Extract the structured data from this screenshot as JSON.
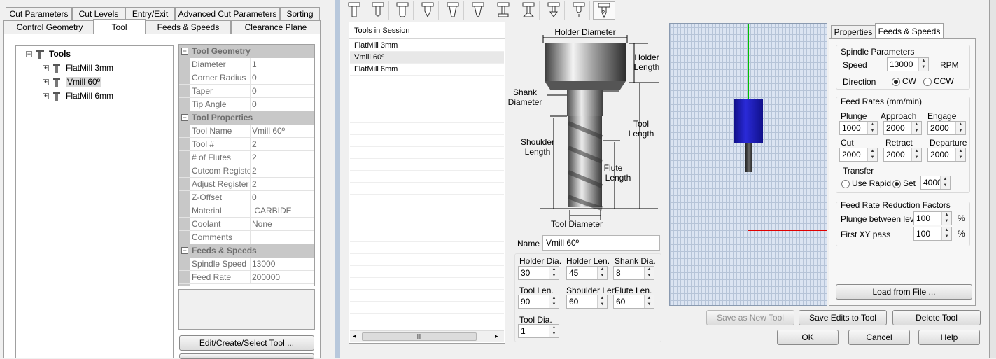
{
  "left_tabs_row1": [
    "Cut Parameters",
    "Cut Levels",
    "Entry/Exit",
    "Advanced Cut Parameters",
    "Sorting"
  ],
  "left_tabs_row2": [
    "Control Geometry",
    "Tool",
    "Feeds & Speeds",
    "Clearance Plane"
  ],
  "tree": {
    "root": "Tools",
    "items": [
      "FlatMill 3mm",
      "Vmill 60º",
      "FlatMill 6mm"
    ]
  },
  "property_grid": {
    "cat_geometry": "Tool Geometry",
    "geometry": [
      {
        "k": "Diameter",
        "v": "1"
      },
      {
        "k": "Corner Radius",
        "v": "0"
      },
      {
        "k": "Taper",
        "v": "0"
      },
      {
        "k": "Tip Angle",
        "v": "0"
      }
    ],
    "cat_properties": "Tool Properties",
    "properties": [
      {
        "k": "Tool Name",
        "v": "Vmill 60º"
      },
      {
        "k": "Tool #",
        "v": "2"
      },
      {
        "k": "# of Flutes",
        "v": "2"
      },
      {
        "k": "Cutcom Registe",
        "v": "2"
      },
      {
        "k": "Adjust Register",
        "v": "2"
      },
      {
        "k": "Z-Offset",
        "v": "0"
      },
      {
        "k": "Material",
        "v": " CARBIDE"
      },
      {
        "k": "Coolant",
        "v": "None"
      },
      {
        "k": "Comments",
        "v": ""
      }
    ],
    "cat_feeds": "Feeds & Speeds",
    "feeds": [
      {
        "k": "Spindle Speed",
        "v": "13000"
      },
      {
        "k": "Feed Rate",
        "v": "200000"
      }
    ]
  },
  "edit_button": "Edit/Create/Select Tool ...",
  "tools_in_session": {
    "header": "Tools in Session",
    "items": [
      "FlatMill 3mm",
      "Vmill 60º",
      "FlatMill 6mm"
    ]
  },
  "diagram": {
    "holder_diameter": "Holder Diameter",
    "holder_length": [
      "Holder",
      "Length"
    ],
    "shank_diameter": [
      "Shank",
      "Diameter"
    ],
    "tool_length": [
      "Tool",
      "Length"
    ],
    "shoulder_length": [
      "Shoulder",
      "Length"
    ],
    "flute_length": [
      "Flute",
      "Length"
    ],
    "tool_diameter": "Tool Diameter"
  },
  "form": {
    "name_label": "Name",
    "name_value": "Vmill 60º",
    "holder_dia_label": "Holder Dia.",
    "holder_dia": "30",
    "holder_len_label": "Holder Len.",
    "holder_len": "45",
    "shank_dia_label": "Shank Dia.",
    "shank_dia": "8",
    "tool_len_label": "Tool Len.",
    "tool_len": "90",
    "shoulder_len_label": "Shoulder Len.",
    "shoulder_len": "60",
    "flute_len_label": "Flute Len.",
    "flute_len": "60",
    "tool_dia_label": "Tool Dia.",
    "tool_dia": "1"
  },
  "right_tabs": [
    "Properties",
    "Feeds & Speeds"
  ],
  "spindle": {
    "title": "Spindle Parameters",
    "speed_label": "Speed",
    "speed": "13000",
    "unit": "RPM",
    "direction_label": "Direction",
    "cw": "CW",
    "ccw": "CCW"
  },
  "feed_rates": {
    "title": "Feed Rates (mm/min)",
    "plunge_label": "Plunge",
    "plunge": "1000",
    "approach_label": "Approach",
    "approach": "2000",
    "engage_label": "Engage",
    "engage": "2000",
    "cut_label": "Cut",
    "cut": "2000",
    "retract_label": "Retract",
    "retract": "2000",
    "departure_label": "Departure",
    "departure": "2000",
    "transfer_label": "Transfer",
    "use_rapid": "Use Rapid",
    "set": "Set",
    "set_value": "4000"
  },
  "reduction": {
    "title": "Feed Rate Reduction Factors",
    "plunge_label": "Plunge between levels",
    "plunge": "100",
    "xy_label": "First XY pass",
    "xy": "100",
    "pct": "%"
  },
  "buttons": {
    "load": "Load from File ...",
    "save_new": "Save as New Tool",
    "save_edits": "Save Edits to Tool",
    "delete": "Delete Tool",
    "ok": "OK",
    "cancel": "Cancel",
    "help": "Help"
  },
  "scrollbar_thumb": "|||",
  "colors": {
    "accent": "#1818a8",
    "axis_green": "#00c000",
    "axis_red": "#e00000",
    "grid_bg": "#dbe4f2"
  }
}
